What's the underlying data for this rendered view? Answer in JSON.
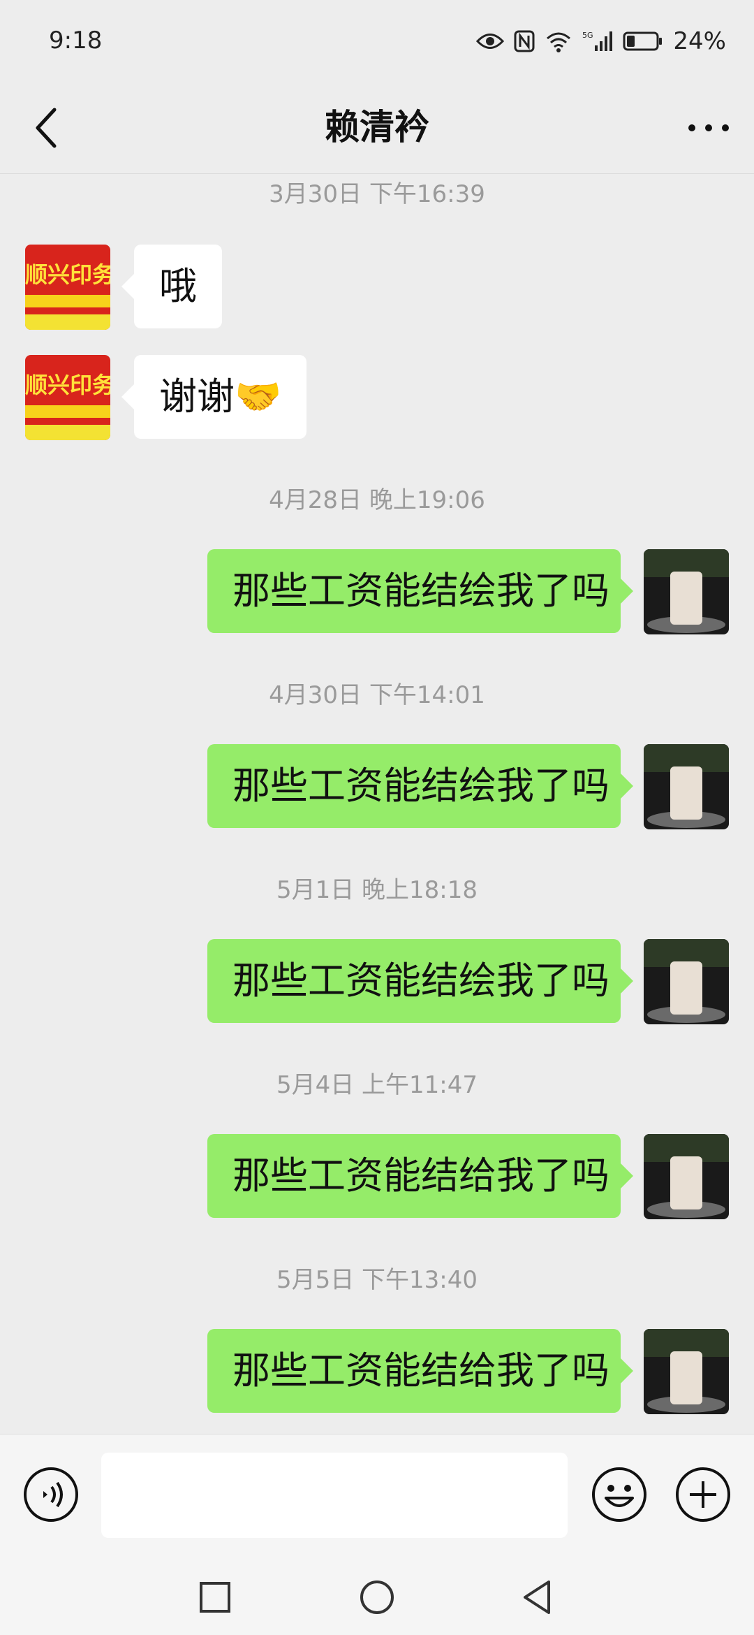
{
  "status_bar": {
    "time": "9:18",
    "battery": "24%"
  },
  "header": {
    "title": "赖清衿"
  },
  "messages": [
    {
      "timestamp": "3月30日 下午16:39"
    },
    {
      "side": "left",
      "text": "哦",
      "avatar_text": "顺兴印务"
    },
    {
      "side": "left",
      "text": "谢谢🤝",
      "avatar_text": "顺兴印务"
    },
    {
      "timestamp": "4月28日 晚上19:06"
    },
    {
      "side": "right",
      "text": "那些工资能结绘我了吗"
    },
    {
      "timestamp": "4月30日 下午14:01"
    },
    {
      "side": "right",
      "text": "那些工资能结绘我了吗"
    },
    {
      "timestamp": "5月1日 晚上18:18"
    },
    {
      "side": "right",
      "text": "那些工资能结绘我了吗"
    },
    {
      "timestamp": "5月4日 上午11:47"
    },
    {
      "side": "right",
      "text": "那些工资能结给我了吗"
    },
    {
      "timestamp": "5月5日 下午13:40"
    },
    {
      "side": "right",
      "text": "那些工资能结给我了吗"
    }
  ],
  "input": {
    "value": ""
  },
  "colors": {
    "background": "#ededed",
    "sent_bubble": "#95ec69",
    "received_bubble": "#ffffff",
    "timestamp": "#9a9a9a"
  },
  "icons": [
    "back-arrow-icon",
    "more-icon",
    "voice-icon",
    "emoji-icon",
    "plus-icon",
    "square-nav-icon",
    "circle-nav-icon",
    "triangle-nav-icon"
  ]
}
